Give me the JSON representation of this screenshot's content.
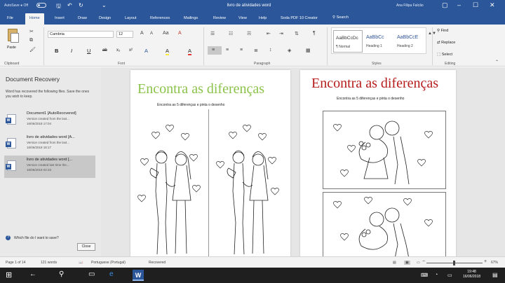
{
  "titlebar": {
    "autosave": "AutoSave ● Off",
    "doc_title": "livro de atividades word",
    "user": "Ana Filipa Falcão",
    "qa_icons": [
      "save-icon",
      "undo-icon",
      "redo-icon"
    ],
    "window_icons": [
      "restore-icon",
      "minimize-icon",
      "maximize-icon",
      "close-icon"
    ]
  },
  "tabs": [
    "File",
    "Home",
    "Insert",
    "Draw",
    "Design",
    "Layout",
    "References",
    "Mailings",
    "Review",
    "View",
    "Help",
    "Soda PDF 10 Creator"
  ],
  "tell_me": "Search",
  "ribbon": {
    "clipboard": {
      "paste": "Paste",
      "label": "Clipboard"
    },
    "font": {
      "name": "Cambria",
      "size": "12",
      "buttons": [
        "B",
        "I",
        "U",
        "ab",
        "x₂",
        "x²",
        "A",
        "A",
        "A"
      ],
      "label": "Font"
    },
    "paragraph": {
      "label": "Paragraph"
    },
    "styles": {
      "items": [
        {
          "sample": "AaBbCcDc",
          "name": "¶ Normal"
        },
        {
          "sample": "AaBbCc",
          "name": "Heading 1"
        },
        {
          "sample": "AaBbCcE",
          "name": "Heading 2"
        }
      ],
      "label": "Styles"
    },
    "editing": {
      "find": "Find",
      "replace": "Replace",
      "select": "Select",
      "label": "Editing"
    }
  },
  "recovery": {
    "title": "Document Recovery",
    "description": "Word has recovered the following files. Save the ones you wish to keep.",
    "items": [
      {
        "name": "Document1 [AutoRecovered]",
        "sub": "Version created from the last...",
        "date": "16/06/2018 17:04"
      },
      {
        "name": "livro de atividades word [A...",
        "sub": "Version created from the last...",
        "date": "16/06/2018 18:17"
      },
      {
        "name": "livro de atividades word [...",
        "sub": "Version created last time the...",
        "date": "16/06/2018 02:33"
      }
    ],
    "question": "Which file do I want to save?",
    "close": "Close"
  },
  "page1": {
    "heading": "Encontra as diferenças",
    "instruction": "Encontra as 5 diferenças e pinta o desenho"
  },
  "page2": {
    "heading": "Encontra as diferenças",
    "instruction": "Encontra as 5 diferenças e pinta o desenho"
  },
  "status": {
    "page": "Page 1 of 14",
    "words": "121 words",
    "language": "Portuguese (Portugal)",
    "recovered": "Recovered",
    "zoom": "67%"
  },
  "taskbar": {
    "time": "19:48",
    "date": "16/06/2018"
  },
  "colors": {
    "word_blue": "#2b579a",
    "heading_green": "#8bc34a",
    "heading_red": "#b71c1c"
  }
}
